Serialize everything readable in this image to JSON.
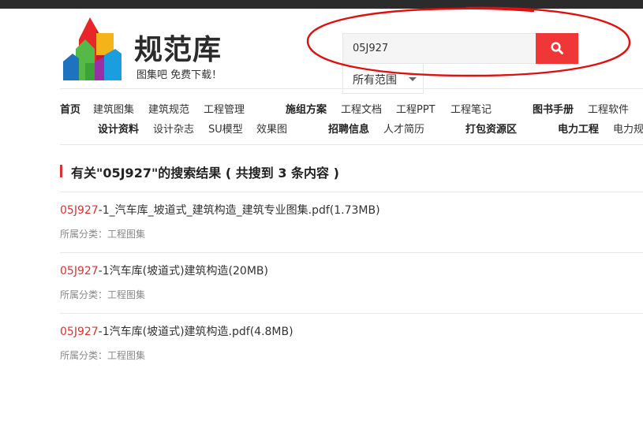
{
  "logo": {
    "title": "规范库",
    "slogan": "图集吧  免费下载！"
  },
  "search": {
    "value": "05J927",
    "scope": "所有范围"
  },
  "nav": {
    "row1": [
      "首页",
      "建筑图集",
      "建筑规范",
      "工程管理",
      "施组方案",
      "工程文档",
      "工程PPT",
      "工程笔记",
      "图书手册",
      "工程软件"
    ],
    "row2": [
      "设计资料",
      "设计杂志",
      "SU模型",
      "效果图",
      "招聘信息",
      "人才简历",
      "打包资源区",
      "电力工程",
      "电力规"
    ]
  },
  "results": {
    "heading": "有关\"05J927\"的搜索结果 ( 共搜到 3 条内容 )",
    "items": [
      {
        "highlight": "05J927",
        "rest": "-1_汽车库_坡道式_建筑构造_建筑专业图集.pdf(1.73MB)",
        "category": "所属分类：工程图集"
      },
      {
        "highlight": "05J927",
        "rest": "-1汽车库(坡道式)建筑构造(20MB)",
        "category": "所属分类：工程图集"
      },
      {
        "highlight": "05J927",
        "rest": "-1汽车库(坡道式)建筑构造.pdf(4.8MB)",
        "category": "所属分类：工程图集"
      }
    ]
  },
  "colors": {
    "accent": "#f03738",
    "highlight": "#e03131",
    "topbar": "#2b2b2b",
    "annotation": "#e01010"
  },
  "icons": {
    "search": "search-icon",
    "caret": "caret-down-icon",
    "logo": "building-blocks-logo-icon"
  }
}
